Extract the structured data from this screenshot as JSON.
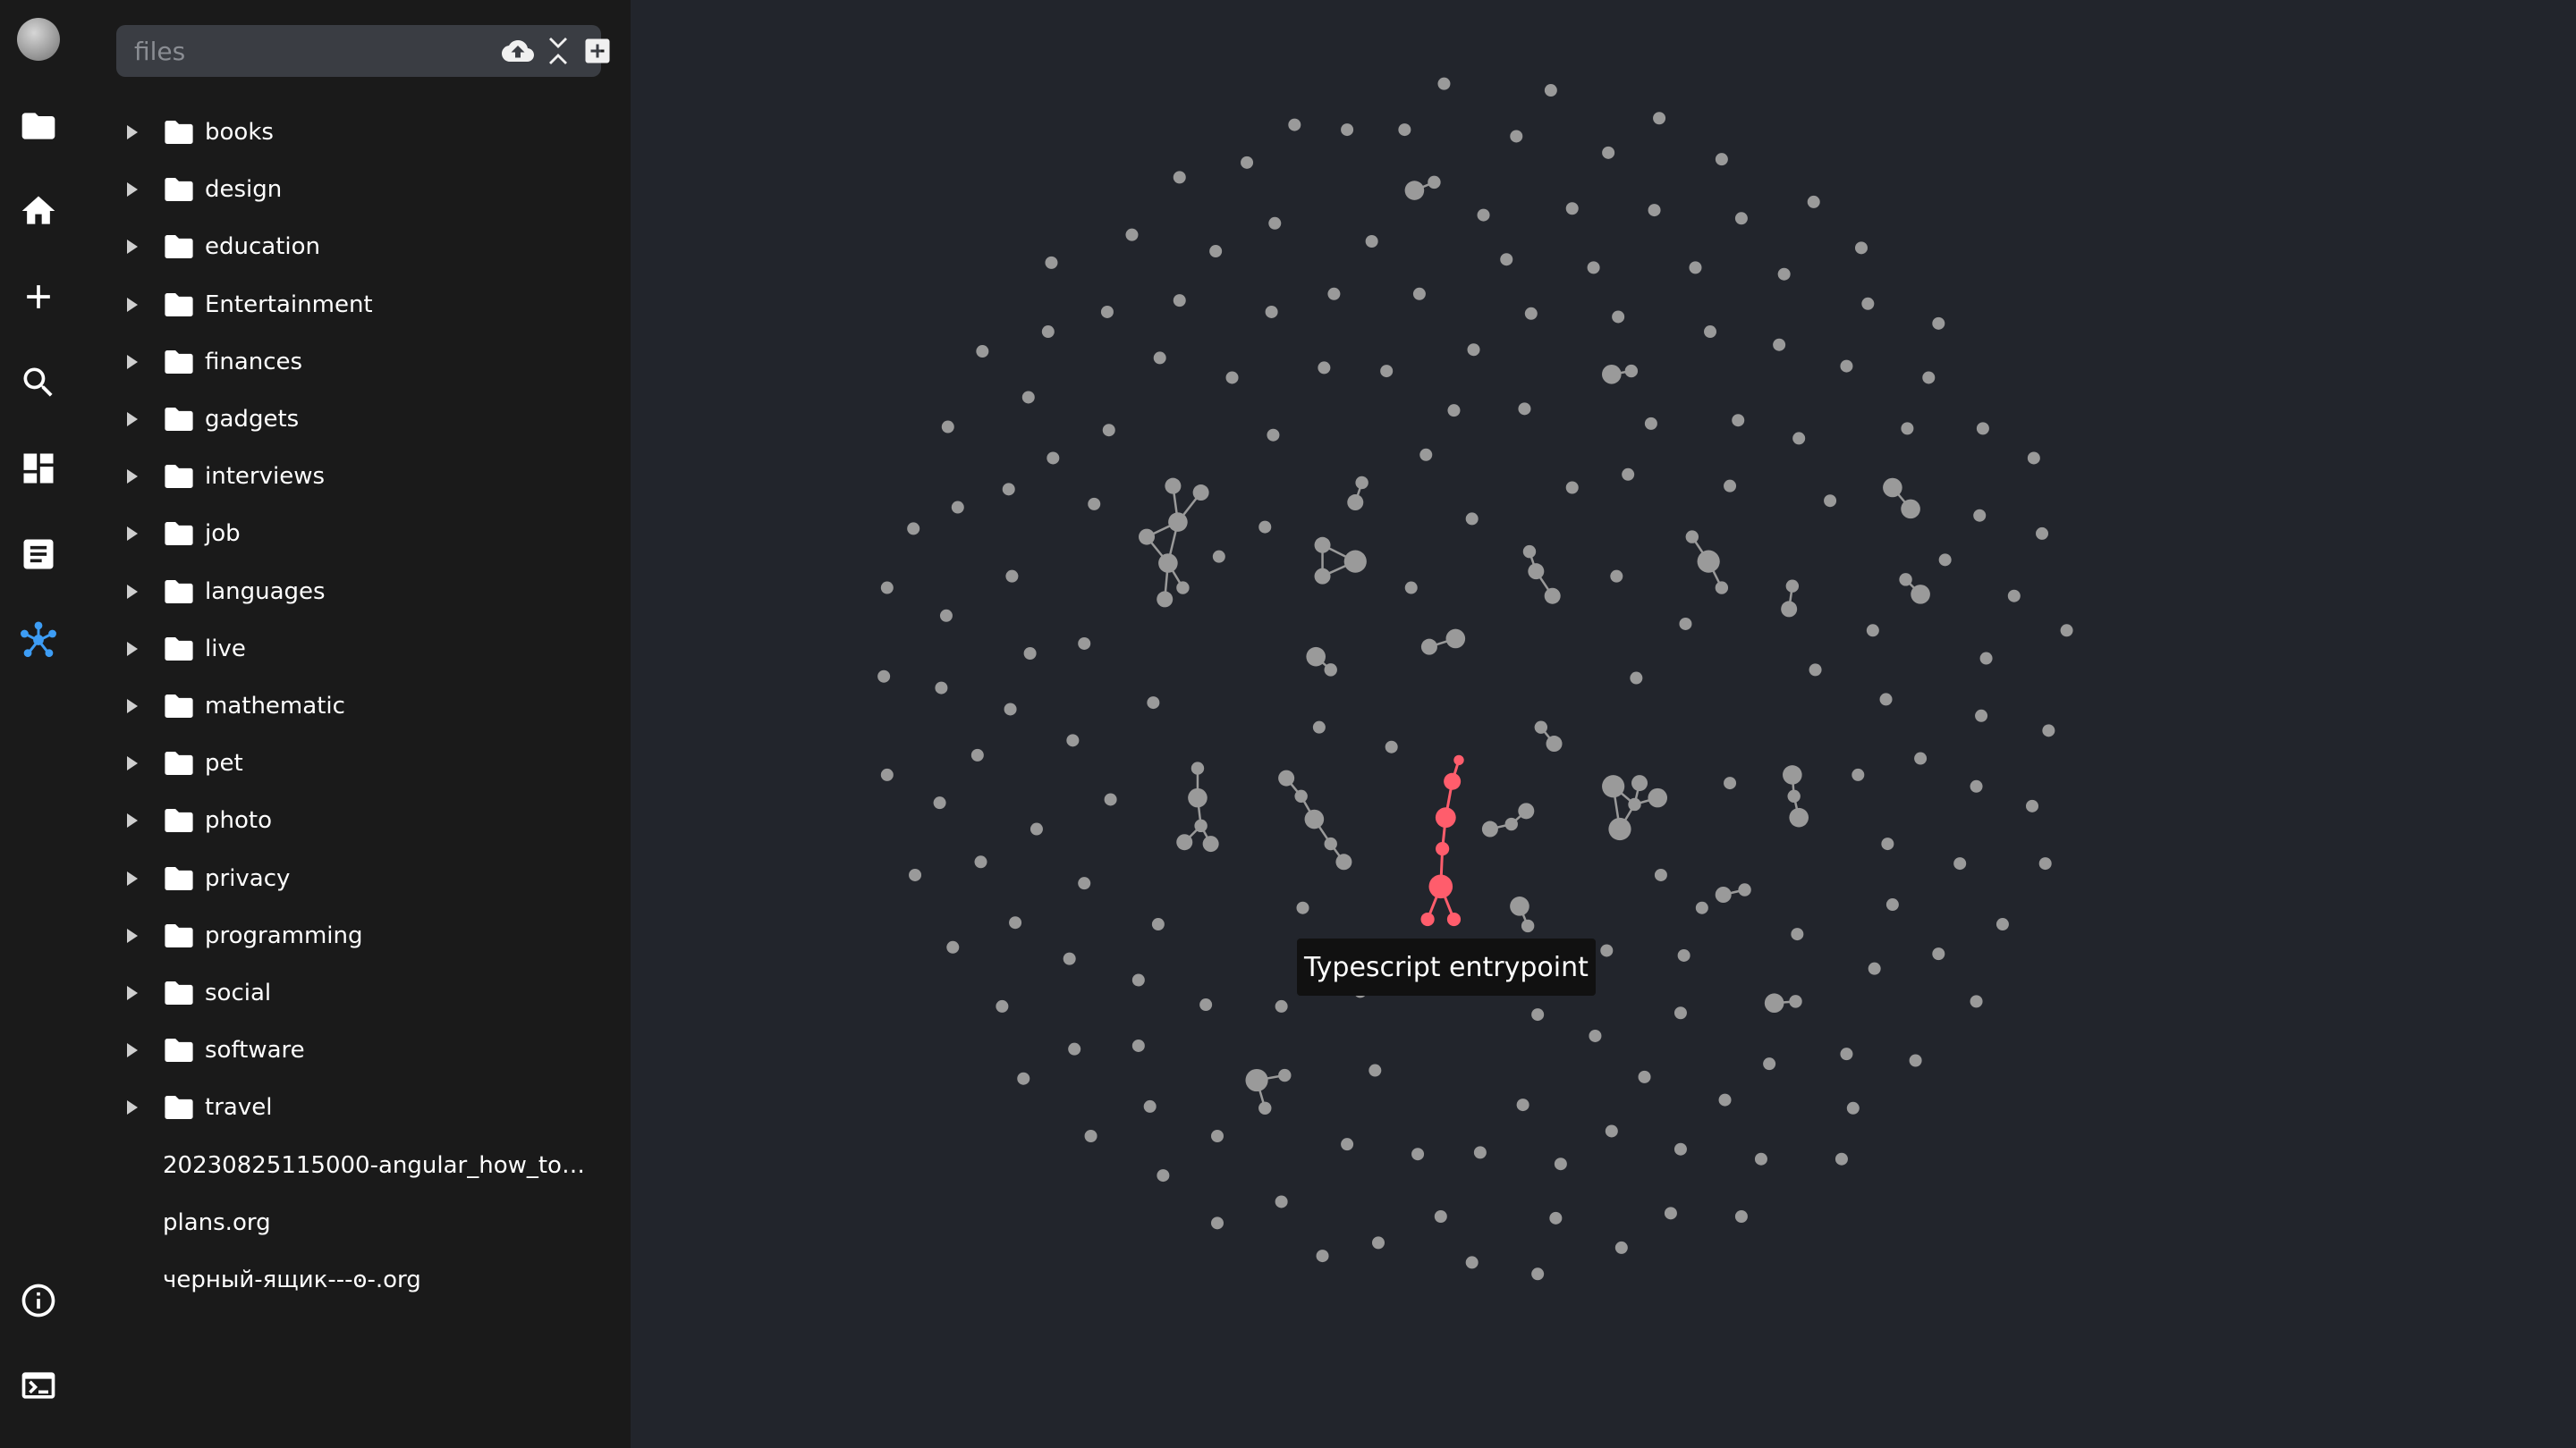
{
  "rail": {
    "items": [
      {
        "name": "avatar",
        "icon": "avatar"
      },
      {
        "name": "folder-icon",
        "icon": "folder"
      },
      {
        "name": "home-icon",
        "icon": "home"
      },
      {
        "name": "plus-icon",
        "icon": "plus"
      },
      {
        "name": "search-icon",
        "icon": "search"
      },
      {
        "name": "dashboard-icon",
        "icon": "dashboard"
      },
      {
        "name": "document-icon",
        "icon": "document"
      },
      {
        "name": "graph-icon",
        "icon": "graph",
        "active": true
      },
      {
        "name": "info-icon",
        "icon": "info"
      },
      {
        "name": "terminal-icon",
        "icon": "terminal"
      }
    ],
    "active_color": "#3d9df5"
  },
  "search": {
    "placeholder": "files",
    "value": ""
  },
  "tree": {
    "folders": [
      {
        "label": "books"
      },
      {
        "label": "design"
      },
      {
        "label": "education"
      },
      {
        "label": "Entertainment"
      },
      {
        "label": "finances"
      },
      {
        "label": "gadgets"
      },
      {
        "label": "interviews"
      },
      {
        "label": "job"
      },
      {
        "label": "languages"
      },
      {
        "label": "live"
      },
      {
        "label": "mathematic"
      },
      {
        "label": "pet"
      },
      {
        "label": "photo"
      },
      {
        "label": "privacy"
      },
      {
        "label": "programming"
      },
      {
        "label": "social"
      },
      {
        "label": "software"
      },
      {
        "label": "travel"
      }
    ],
    "files": [
      {
        "label": "20230825115000-angular_how_to_s..."
      },
      {
        "label": "plans.org"
      },
      {
        "label": "черный-ящик---ꙩ-.org"
      }
    ]
  },
  "graph": {
    "tooltip": "Typescript entrypoint",
    "node_color": "#9a9a9a",
    "highlight_color": "#ff5d6c"
  }
}
